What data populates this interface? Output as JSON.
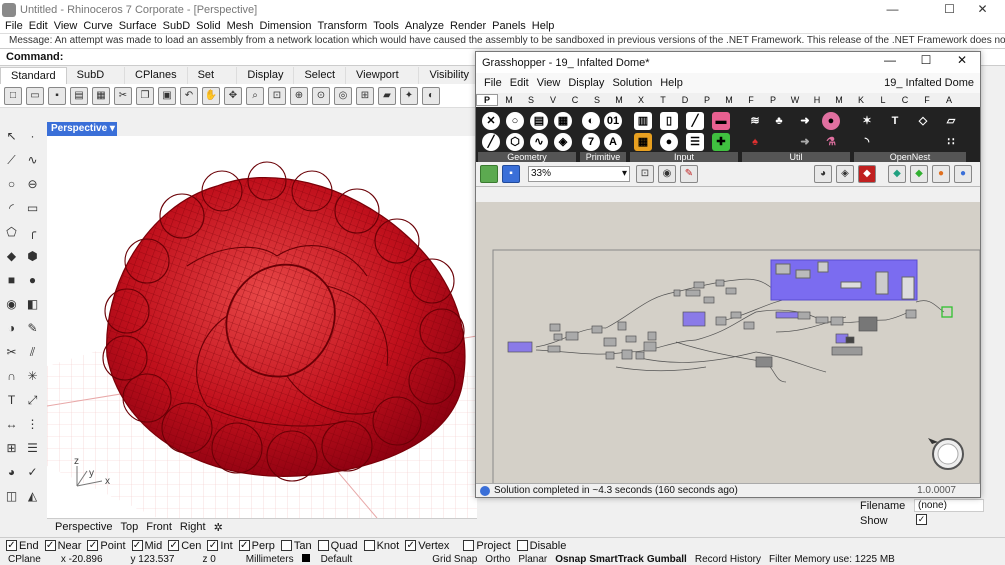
{
  "title": "Untitled - Rhinoceros 7 Corporate - [Perspective]",
  "window_controls": {
    "minimize": "—",
    "maximize": "☐",
    "close": "✕"
  },
  "menu": [
    "File",
    "Edit",
    "View",
    "Curve",
    "Surface",
    "SubD",
    "Solid",
    "Mesh",
    "Dimension",
    "Transform",
    "Tools",
    "Analyze",
    "Render",
    "Panels",
    "Help"
  ],
  "command_history": "Message: An attempt was made to load an assembly from a network location which would have caused the assembly to be sandboxed in previous versions of the .NET Framework. This release of the .NET Framework does not enable CAS",
  "command_label": "Command:",
  "toolbar_tabs": [
    "Standard",
    "SubD Tools",
    "CPlanes",
    "Set View",
    "Display",
    "Select",
    "Viewport Layout",
    "Visibility"
  ],
  "viewport_label": "Perspective",
  "viewport_tabs": [
    "Perspective",
    "Top",
    "Front",
    "Right"
  ],
  "axes": {
    "x": "x",
    "y": "y",
    "z": "z"
  },
  "osnaps": [
    {
      "label": "End",
      "checked": true
    },
    {
      "label": "Near",
      "checked": true
    },
    {
      "label": "Point",
      "checked": true
    },
    {
      "label": "Mid",
      "checked": true
    },
    {
      "label": "Cen",
      "checked": true
    },
    {
      "label": "Int",
      "checked": true
    },
    {
      "label": "Perp",
      "checked": true
    },
    {
      "label": "Tan",
      "checked": false
    },
    {
      "label": "Quad",
      "checked": false
    },
    {
      "label": "Knot",
      "checked": false
    },
    {
      "label": "Vertex",
      "checked": true
    },
    {
      "label": "Project",
      "checked": false
    },
    {
      "label": "Disable",
      "checked": false
    }
  ],
  "statusbar": {
    "cplane": "CPlane",
    "x": "x -20.896",
    "y": "y 123.537",
    "z": "z 0",
    "units": "Millimeters",
    "layer": "Default",
    "toggles": [
      "Grid Snap",
      "Ortho",
      "Planar",
      "Osnap",
      "SmartTrack",
      "Gumball",
      "Record History",
      "Filter"
    ],
    "memory": "Memory use: 1225 MB"
  },
  "properties": {
    "filename_label": "Filename",
    "filename_value": "(none)",
    "show_label": "Show"
  },
  "grasshopper": {
    "title": "Grasshopper - 19_ Infalted Dome*",
    "doc_name": "19_ Infalted Dome",
    "menu": [
      "File",
      "Edit",
      "View",
      "Display",
      "Solution",
      "Help"
    ],
    "tabs": [
      "P",
      "M",
      "S",
      "V",
      "C",
      "S",
      "M",
      "X",
      "T",
      "D",
      "P",
      "M",
      "F",
      "P",
      "W",
      "H",
      "M",
      "K",
      "L",
      "C",
      "F",
      "A"
    ],
    "groups": [
      "Geometry",
      "Primitive",
      "Input",
      "Util",
      "OpenNest"
    ],
    "zoom": "33%",
    "status": "Solution completed in ~4.3 seconds (160 seconds ago)",
    "version": "1.0.0007"
  },
  "colors": {
    "mesh": "#c0101c",
    "accent": "#3a6fd8",
    "gh_group": "#7b6cf0",
    "canvas": "#d4d0c8"
  }
}
